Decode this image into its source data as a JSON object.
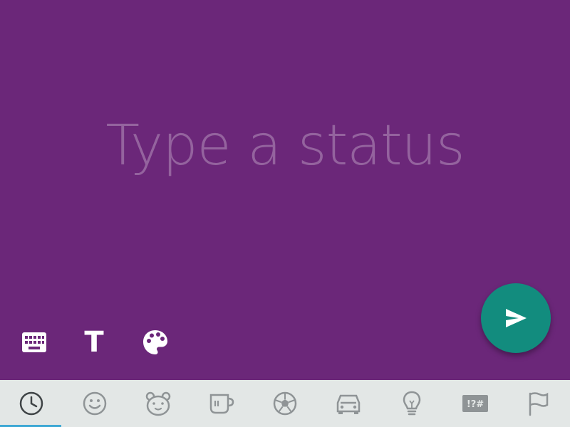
{
  "status": {
    "placeholder": "Type a status",
    "value": ""
  },
  "toolbar": {
    "keyboard_icon": "keyboard-icon",
    "text_style_label": "T",
    "palette_icon": "palette-icon"
  },
  "send": {
    "icon": "send-icon"
  },
  "emoji_categories": [
    {
      "name": "recent",
      "icon": "clock-icon",
      "active": true
    },
    {
      "name": "smileys",
      "icon": "smiley-icon",
      "active": false
    },
    {
      "name": "animals",
      "icon": "bear-icon",
      "active": false
    },
    {
      "name": "food",
      "icon": "cup-icon",
      "active": false
    },
    {
      "name": "activities",
      "icon": "soccer-ball-icon",
      "active": false
    },
    {
      "name": "travel",
      "icon": "car-icon",
      "active": false
    },
    {
      "name": "objects",
      "icon": "lightbulb-icon",
      "active": false
    },
    {
      "name": "symbols",
      "icon": "symbols-icon",
      "label": "!?#",
      "active": false
    },
    {
      "name": "flags",
      "icon": "flag-icon",
      "active": false
    }
  ],
  "colors": {
    "background": "#6b2779",
    "fab": "#128c7e",
    "emoji_bar": "#e3e7e6",
    "emoji_icon": "#8f9496",
    "active_icon": "#3f4446",
    "active_indicator": "#3ea8d4"
  }
}
